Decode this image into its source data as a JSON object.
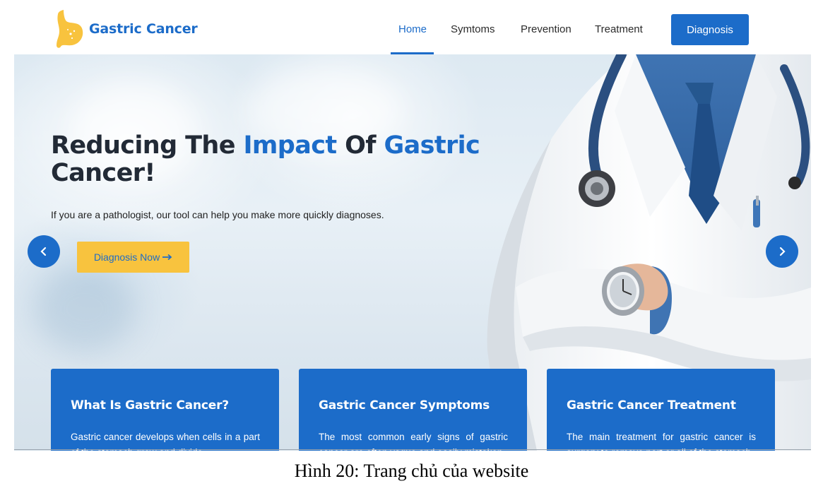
{
  "brand": {
    "name": "Gastric Cancer",
    "logo_icon": "stomach-icon",
    "accent": "#1c6cc9",
    "logo_color": "#f8c33e"
  },
  "nav": {
    "items": [
      {
        "label": "Home",
        "active": true
      },
      {
        "label": "Symtoms",
        "active": false
      },
      {
        "label": "Prevention",
        "active": false
      },
      {
        "label": "Treatment",
        "active": false
      }
    ],
    "cta_label": "Diagnosis"
  },
  "hero": {
    "title_part1": "Reducing The ",
    "title_highlight1": "Impact",
    "title_part2": " Of ",
    "title_highlight2": "Gastric",
    "title_part3": "Cancer!",
    "subtitle": "If you are a pathologist, our tool can help you make more quickly diagnoses.",
    "cta_label": "Diagnosis Now",
    "cta_icon": "arrow-right-icon",
    "prev_icon": "chevron-left-icon",
    "next_icon": "chevron-right-icon"
  },
  "cards": [
    {
      "title": "What Is Gastric Cancer?",
      "text": "Gastric cancer develops when cells in a part of the stomach grow and divide"
    },
    {
      "title": "Gastric Cancer Symptoms",
      "text": "The most common early signs of gastric cancer are often vague and easily mistaken"
    },
    {
      "title": "Gastric Cancer Treatment",
      "text": "The main treatment for gastric cancer is surgery to remove part or all of the stomach"
    }
  ],
  "caption": "Hình 20: Trang chủ của website",
  "colors": {
    "primary": "#1c6cc9",
    "cta_yellow": "#f8c33e",
    "title_dark": "#222a36"
  }
}
